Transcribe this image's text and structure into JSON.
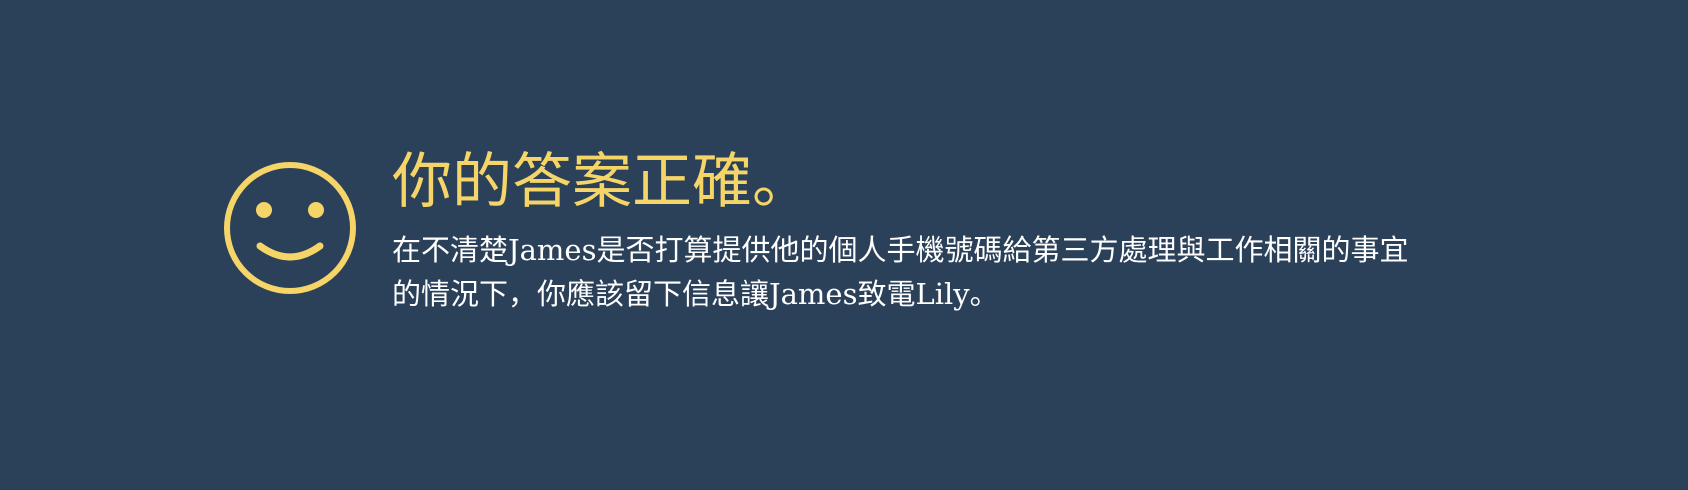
{
  "feedback": {
    "icon": "smiley-face-icon",
    "title": "你的答案正確。",
    "message_lines": [
      "在不清楚James是否打算提供他的個人手機號碼給第三方處理與工作相關的事宜",
      "的情況下，你應該留下信息讓James致電Lily。"
    ]
  },
  "colors": {
    "background": "#2b4059",
    "accent": "#f5d468",
    "text": "#ffffff"
  }
}
